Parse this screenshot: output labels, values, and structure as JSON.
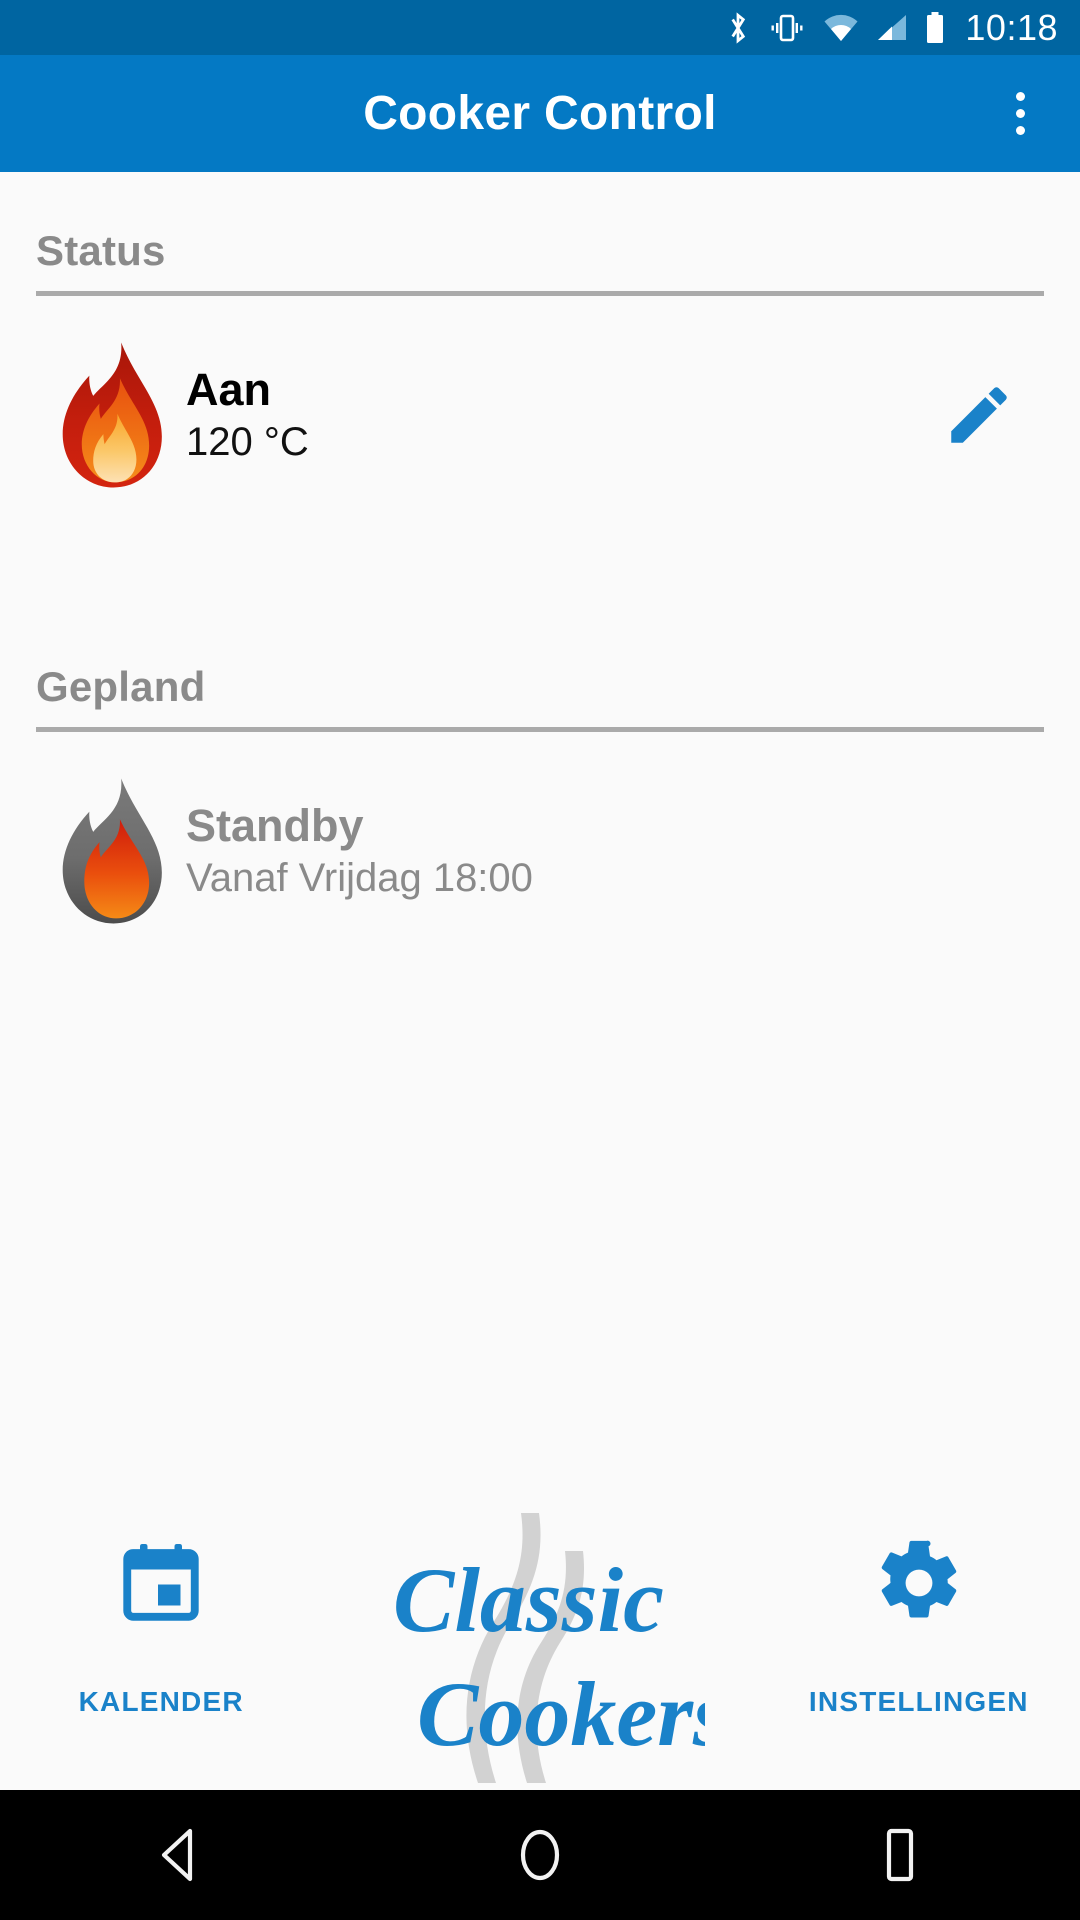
{
  "statusbar": {
    "time": "10:18",
    "icons": [
      "bluetooth-icon",
      "vibrate-icon",
      "wifi-icon",
      "cellular-signal-icon",
      "battery-icon"
    ]
  },
  "appbar": {
    "title": "Cooker Control",
    "overflow_label": "overflow-menu",
    "background": "#0479c4"
  },
  "sections": [
    {
      "header": "Status",
      "item": {
        "icon": "flame-icon-lit",
        "title": "Aan",
        "subtitle": "120 °C",
        "action_icon": "pencil-edit-icon",
        "action_color": "#1a82c9"
      }
    },
    {
      "header": "Gepland",
      "item": {
        "icon": "flame-icon-grey",
        "title": "Standby",
        "subtitle": "Vanaf Vrijdag 18:00"
      }
    }
  ],
  "bottombar": {
    "left_tab": {
      "icon": "calendar-icon",
      "label": "KALENDER"
    },
    "brand": {
      "line1": "Classic",
      "line2": "Cookers"
    },
    "right_tab": {
      "icon": "gear-icon",
      "label": "INSTELLINGEN"
    },
    "accent": "#1a82c9"
  },
  "navbar": {
    "back": "back-triangle-icon",
    "home": "home-circle-icon",
    "recents": "recents-square-icon"
  }
}
